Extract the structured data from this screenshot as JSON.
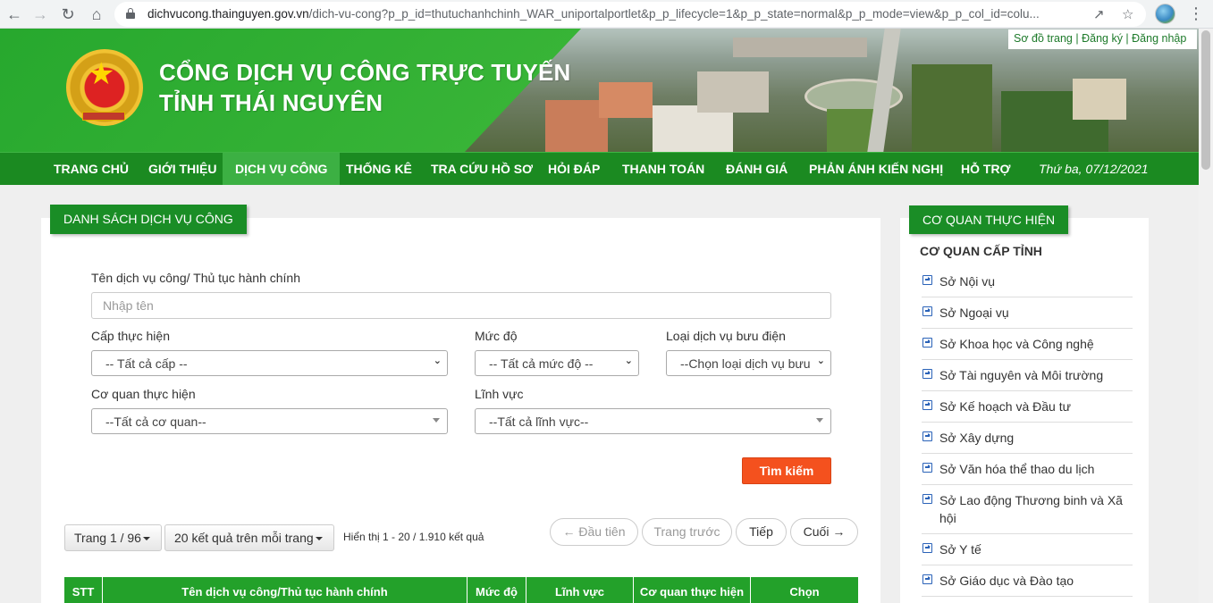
{
  "browser": {
    "url_domain": "dichvucong.thainguyen.gov.vn",
    "url_path": "/dich-vu-cong?p_p_id=thutuchanhchinh_WAR_uniportalportlet&p_p_lifecycle=1&p_p_state=normal&p_p_mode=view&p_p_col_id=colu..."
  },
  "top_links": [
    "Sơ đồ trang",
    "Đăng ký",
    "Đăng nhập"
  ],
  "site": {
    "title_line1": "CỔNG DỊCH VỤ CÔNG TRỰC TUYẾN",
    "title_line2": "TỈNH THÁI NGUYÊN"
  },
  "nav": {
    "items": [
      "TRANG CHỦ",
      "GIỚI THIỆU",
      "DỊCH VỤ CÔNG",
      "THỐNG KÊ",
      "TRA CỨU HỒ SƠ",
      "HỎI ĐÁP",
      "THANH TOÁN",
      "ĐÁNH GIÁ",
      "PHẢN ÁNH KIẾN NGHỊ",
      "HỖ TRỢ"
    ],
    "active": "DỊCH VỤ CÔNG",
    "date": "Thứ ba, 07/12/2021"
  },
  "main": {
    "header": "DANH SÁCH DỊCH VỤ CÔNG",
    "name_label": "Tên dịch vụ công/ Thủ tục hành chính",
    "name_placeholder": "Nhập tên",
    "level_label": "Cấp thực hiện",
    "level_value": "-- Tất cả cấp --",
    "degree_label": "Mức độ",
    "degree_value": "-- Tất cả mức độ --",
    "postal_label": "Loại dịch vụ bưu điện",
    "postal_value": "--Chọn loại dịch vụ bưu",
    "agency_label": "Cơ quan thực hiện",
    "agency_value": "--Tất cả cơ quan--",
    "field_label": "Lĩnh vực",
    "field_value": "--Tất cả lĩnh vực--",
    "search_button": "Tìm kiếm",
    "page_select": "Trang 1 / 96",
    "per_page_select": "20 kết quả trên mỗi trang",
    "result_info": "Hiển thị 1 - 20 / 1.910 kết quả",
    "pager": {
      "first": "← Đầu tiên",
      "prev": "Trang trước",
      "next": "Tiếp",
      "last": "Cuối →"
    },
    "table_headers": [
      "STT",
      "Tên dịch vụ công/Thủ tục hành chính",
      "Mức độ",
      "Lĩnh vực",
      "Cơ quan thực hiện",
      "Chọn"
    ]
  },
  "sidebar": {
    "header": "CƠ QUAN THỰC HIỆN",
    "subheader": "CƠ QUAN CẤP TỈNH",
    "items": [
      "Sở Nội vụ",
      "Sở Ngoại vụ",
      "Sở Khoa học và Công nghệ",
      "Sở Tài nguyên và Môi trường",
      "Sở Kế hoạch và Đầu tư",
      "Sở Xây dựng",
      "Sở Văn hóa thể thao du lịch",
      "Sở Lao động Thương binh và Xã hội",
      "Sở Y tế",
      "Sở Giáo dục và Đào tạo"
    ]
  },
  "colors": {
    "brand_green": "#23a12a",
    "nav_green": "#1b8a21",
    "search_orange": "#f4511e",
    "link_blue": "#2a62b8"
  }
}
